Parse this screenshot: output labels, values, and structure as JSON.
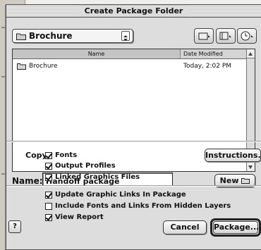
{
  "dialog": {
    "title": "Create Package Folder"
  },
  "location": {
    "selected": "Brochure"
  },
  "list": {
    "columns": [
      "Name",
      "Date Modified"
    ],
    "rows": [
      {
        "name": "Brochure",
        "date": "Today, 2:02 PM"
      }
    ]
  },
  "name_row": {
    "label": "Name:",
    "value": "Handoff package",
    "new_label": "New"
  },
  "options": {
    "copy_label": "Copy:",
    "instructions_label": "Instructions...",
    "fonts": {
      "label": "Fonts",
      "checked": true
    },
    "output_profiles": {
      "label": "Output Profiles",
      "checked": true
    },
    "linked_graphics": {
      "label": "Linked Graphics Files",
      "checked": true
    },
    "update_links": {
      "label": "Update Graphic Links In Package",
      "checked": true
    },
    "hidden_layers": {
      "label": "Include Fonts and Links From Hidden Layers",
      "checked": false
    },
    "view_report": {
      "label": "View Report",
      "checked": true
    }
  },
  "footer": {
    "help_label": "?",
    "cancel_label": "Cancel",
    "package_label": "Package..."
  }
}
